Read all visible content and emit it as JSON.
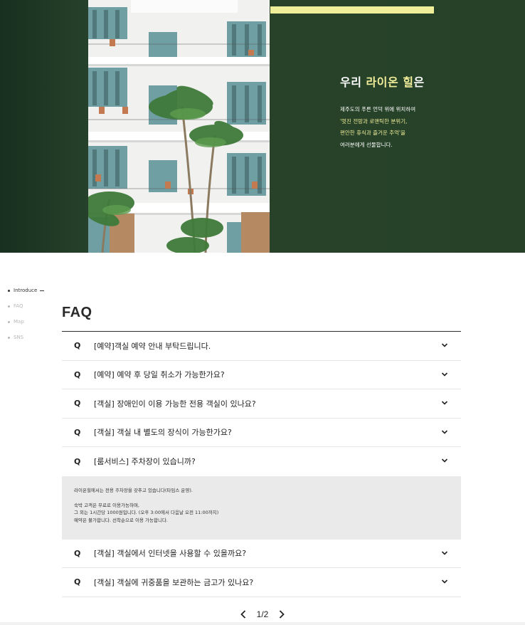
{
  "hero": {
    "title_prefix": "우리 ",
    "title_highlight": "라이온 힐",
    "title_suffix": "은",
    "lines": [
      {
        "text": "제주도의 푸른 언덕 위에 위치하여",
        "highlight": false
      },
      {
        "text": "'멋진 전망과 로맨틱한 분위기,",
        "highlight": true
      },
      {
        "text": "편안한 휴식과 즐거운 추억'을",
        "highlight": true
      },
      {
        "text": "여러분에게 선물합니다.",
        "highlight": false
      }
    ],
    "colors": {
      "background": "#264128",
      "accent": "#f1ee9a"
    }
  },
  "sidenav": {
    "items": [
      {
        "label": "Introduce",
        "active": true
      },
      {
        "label": "FAQ",
        "active": false
      },
      {
        "label": "Map",
        "active": false
      },
      {
        "label": "SNS",
        "active": false
      }
    ]
  },
  "faq": {
    "title": "FAQ",
    "q_marker": "Q",
    "items": [
      {
        "question": "[예약]객실 예약 안내 부탁드립니다.",
        "expanded": false
      },
      {
        "question": "[예약] 예약 후 당일 취소가 가능한가요?",
        "expanded": false
      },
      {
        "question": "[객실] 장애인이 이용 가능한 전용 객실이 있나요?",
        "expanded": false
      },
      {
        "question": "[객실] 객실 내 별도의 장식이 가능한가요?",
        "expanded": false
      },
      {
        "question": "[룸서비스] 주차장이 있습니까?",
        "expanded": true,
        "answer": [
          "라이온힐에서는 전용 주차장을 갖추고 있습니다(타임스 운영).",
          "",
          "숙박 고객은 무료로 이용가능하며,",
          "그 외는 1시간당 1000원입니다. (오후 3:00에서 다음날 오전 11:00까지)",
          "예약은 불가합니다. 선착순으로 이용 가능합니다."
        ]
      },
      {
        "question": "[객실] 객실에서 인터넷을 사용할 수 있을까요?",
        "expanded": false
      },
      {
        "question": "[객실] 객실에 귀중품을 보관하는 금고가 있나요?",
        "expanded": false
      }
    ]
  },
  "pagination": {
    "label": "1/2",
    "prev_icon": "chevron-left-icon",
    "next_icon": "chevron-right-icon"
  }
}
